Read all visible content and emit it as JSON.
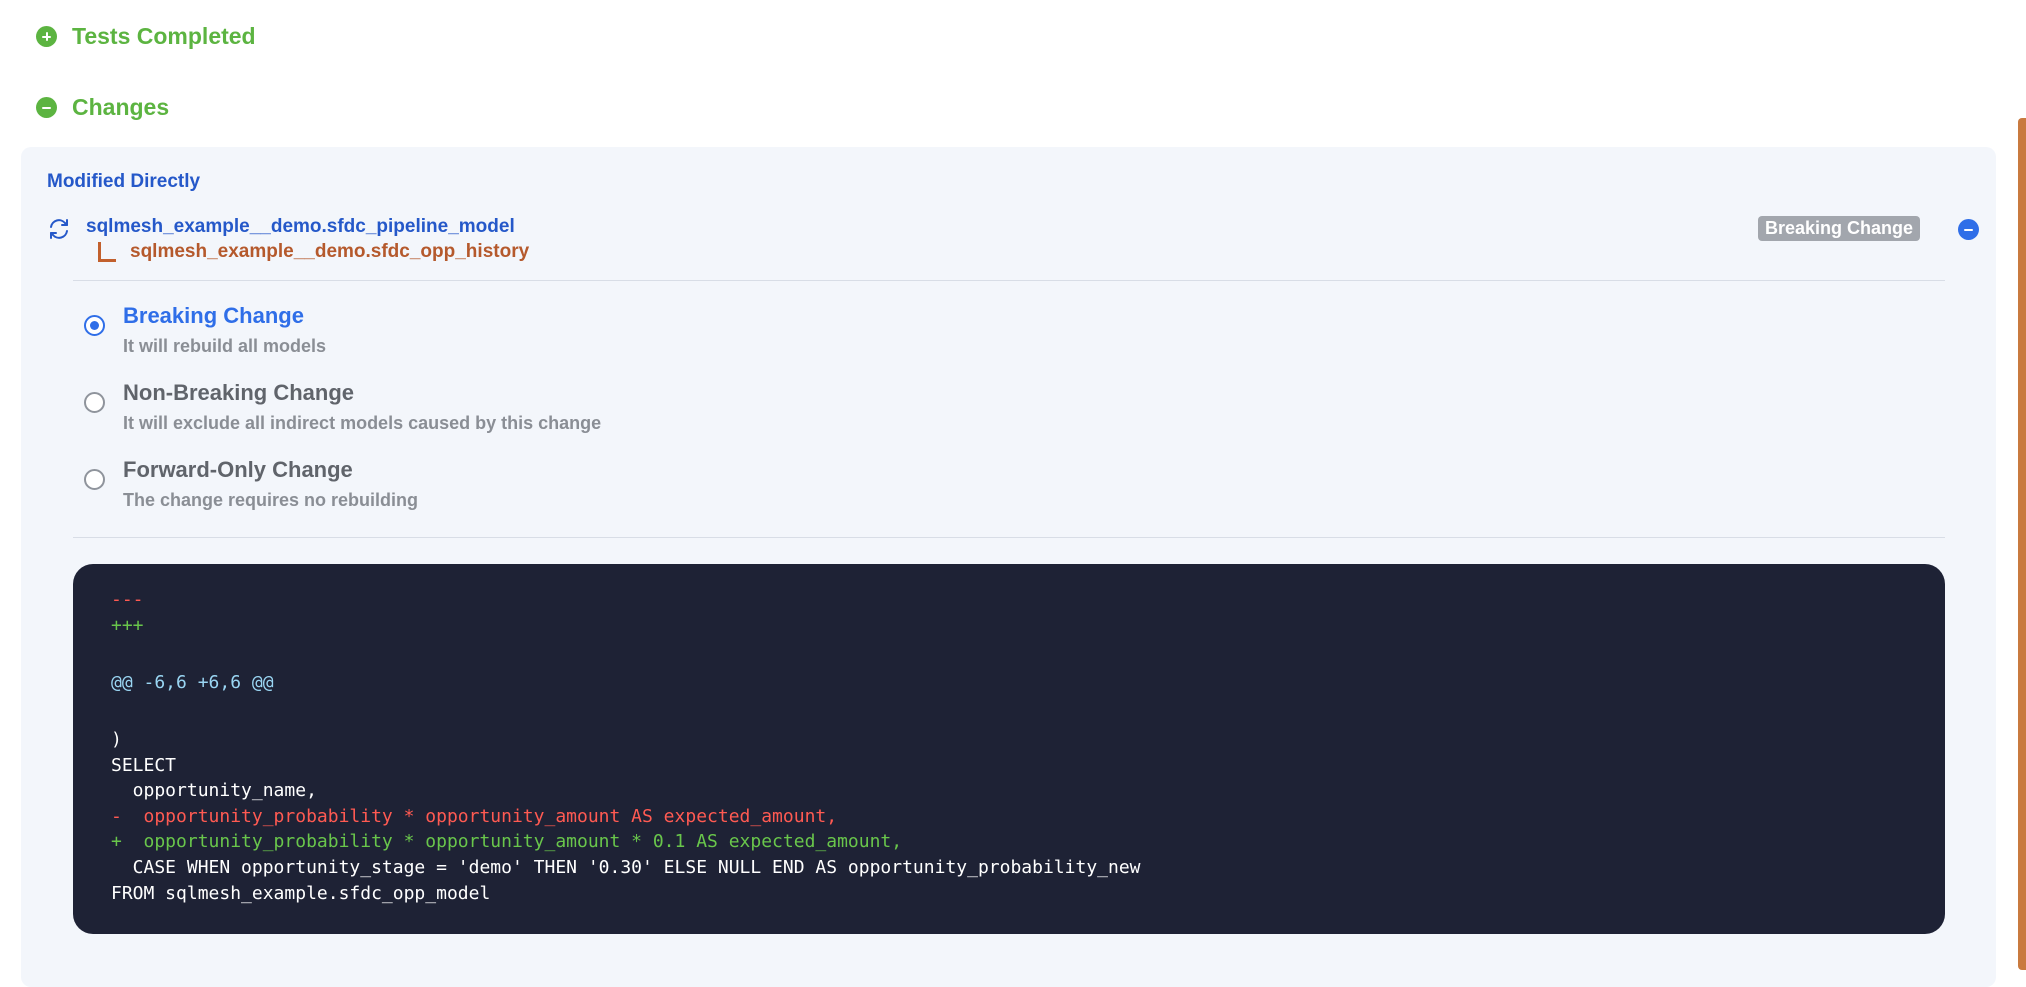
{
  "sections": {
    "tests_completed": {
      "title": "Tests Completed",
      "icon": "plus-circle-icon",
      "expanded": false
    },
    "changes": {
      "title": "Changes",
      "icon": "minus-circle-icon",
      "expanded": true
    }
  },
  "changes_panel": {
    "heading": "Modified Directly",
    "model": {
      "icon": "refresh-icon",
      "name": "sqlmesh_example__demo.sfdc_pipeline_model",
      "child": "sqlmesh_example__demo.sfdc_opp_history",
      "badge": "Breaking Change",
      "collapse_icon": "minus-circle-icon"
    },
    "options": [
      {
        "label": "Breaking Change",
        "description": "It will rebuild all models",
        "selected": true
      },
      {
        "label": "Non-Breaking Change",
        "description": "It will exclude all indirect models caused by this change",
        "selected": false
      },
      {
        "label": "Forward-Only Change",
        "description": "The change requires no rebuilding",
        "selected": false
      }
    ],
    "diff": {
      "header_del": "---",
      "header_add": "+++",
      "hunk": "@@ -6,6 +6,6 @@",
      "lines": [
        {
          "type": "ctx",
          "text": ")"
        },
        {
          "type": "ctx",
          "text": "SELECT"
        },
        {
          "type": "ctx",
          "text": "  opportunity_name,"
        },
        {
          "type": "del",
          "text": "-  opportunity_probability * opportunity_amount AS expected_amount,"
        },
        {
          "type": "add",
          "text": "+  opportunity_probability * opportunity_amount * 0.1 AS expected_amount,"
        },
        {
          "type": "ctx",
          "text": "  CASE WHEN opportunity_stage = 'demo' THEN '0.30' ELSE NULL END AS opportunity_probability_new"
        },
        {
          "type": "ctx",
          "text": "FROM sqlmesh_example.sfdc_opp_model"
        }
      ]
    }
  },
  "colors": {
    "success": "#5cb441",
    "primary": "#2f6ee8",
    "child_model": "#b5592c",
    "code_bg": "#1e2235",
    "diff_del": "#ff5a52",
    "diff_add": "#69c64b"
  }
}
